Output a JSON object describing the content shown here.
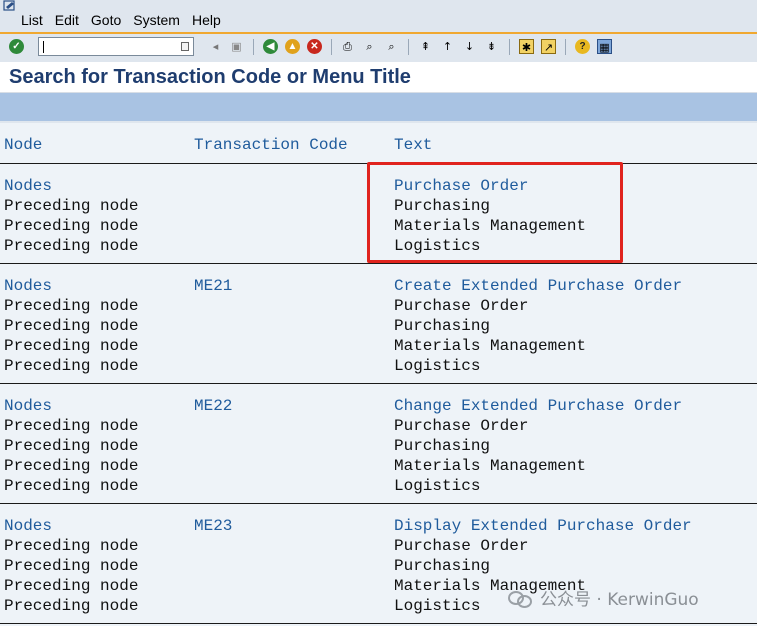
{
  "menubar": {
    "items": [
      "List",
      "Edit",
      "Goto",
      "System",
      "Help"
    ]
  },
  "toolbar": {
    "command_field_value": "",
    "icons": [
      "enter-icon",
      "back-icon",
      "exit-icon",
      "cancel-icon",
      "print-icon",
      "find-icon",
      "find-next-icon",
      "first-page-icon",
      "previous-page-icon",
      "next-page-icon",
      "last-page-icon",
      "create-session-icon",
      "shortcut-icon",
      "help-icon",
      "layout-menu-icon"
    ]
  },
  "title": "Search for Transaction Code or Menu Title",
  "headers": {
    "node": "Node",
    "tcode": "Transaction Code",
    "text": "Text"
  },
  "groups": [
    {
      "rows": [
        {
          "node": "Nodes",
          "tcode": "",
          "text": "Purchase Order",
          "highlight": true
        },
        {
          "node": "Preceding node",
          "tcode": "",
          "text": "Purchasing"
        },
        {
          "node": "Preceding node",
          "tcode": "",
          "text": "Materials Management"
        },
        {
          "node": "Preceding node",
          "tcode": "",
          "text": "Logistics"
        }
      ]
    },
    {
      "rows": [
        {
          "node": "Nodes",
          "tcode": "ME21",
          "text": "Create Extended Purchase Order",
          "highlight": true
        },
        {
          "node": "Preceding node",
          "tcode": "",
          "text": "Purchase Order"
        },
        {
          "node": "Preceding node",
          "tcode": "",
          "text": "Purchasing"
        },
        {
          "node": "Preceding node",
          "tcode": "",
          "text": "Materials Management"
        },
        {
          "node": "Preceding node",
          "tcode": "",
          "text": "Logistics"
        }
      ]
    },
    {
      "rows": [
        {
          "node": "Nodes",
          "tcode": "ME22",
          "text": "Change Extended Purchase Order",
          "highlight": true
        },
        {
          "node": "Preceding node",
          "tcode": "",
          "text": "Purchase Order"
        },
        {
          "node": "Preceding node",
          "tcode": "",
          "text": "Purchasing"
        },
        {
          "node": "Preceding node",
          "tcode": "",
          "text": "Materials Management"
        },
        {
          "node": "Preceding node",
          "tcode": "",
          "text": "Logistics"
        }
      ]
    },
    {
      "rows": [
        {
          "node": "Nodes",
          "tcode": "ME23",
          "text": "Display Extended Purchase Order",
          "highlight": true
        },
        {
          "node": "Preceding node",
          "tcode": "",
          "text": "Purchase Order"
        },
        {
          "node": "Preceding node",
          "tcode": "",
          "text": "Purchasing"
        },
        {
          "node": "Preceding node",
          "tcode": "",
          "text": "Materials Management"
        },
        {
          "node": "Preceding node",
          "tcode": "",
          "text": "Logistics"
        }
      ]
    }
  ],
  "watermark": "公众号 · KerwinGuo",
  "colors": {
    "link": "#1f5b9c",
    "title": "#1f3d6f",
    "highlight_box": "#e0231e",
    "toolbar_accent": "#f0a830"
  }
}
